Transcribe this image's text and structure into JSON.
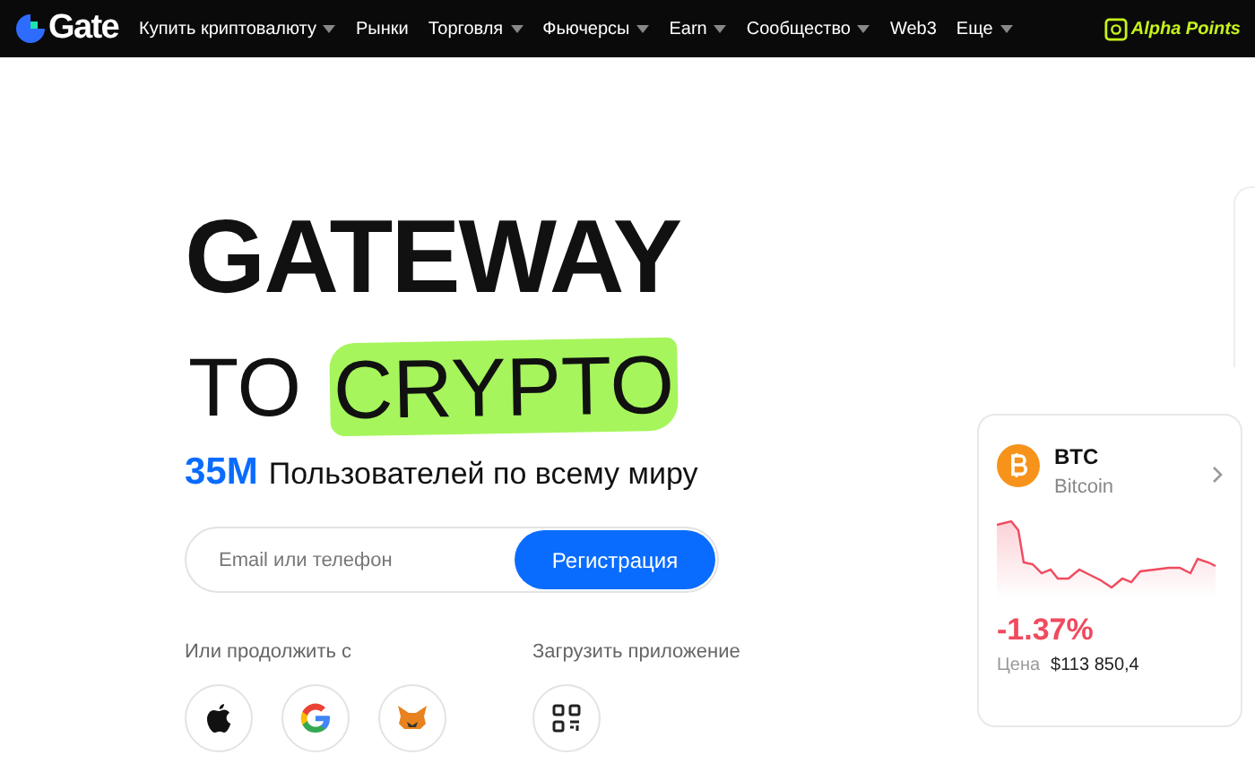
{
  "nav": {
    "logo": "Gate",
    "items": [
      {
        "label": "Купить криптовалюту",
        "dropdown": true
      },
      {
        "label": "Рынки",
        "dropdown": false
      },
      {
        "label": "Торговля",
        "dropdown": true
      },
      {
        "label": "Фьючерсы",
        "dropdown": true
      },
      {
        "label": "Earn",
        "dropdown": true
      },
      {
        "label": "Сообщество",
        "dropdown": true
      },
      {
        "label": "Web3",
        "dropdown": false
      },
      {
        "label": "Еще",
        "dropdown": true
      }
    ],
    "promo": "Alpha Points"
  },
  "hero": {
    "headline_1": "GATEWAY",
    "headline_2": [
      {
        "text": "TO",
        "highlighted": false
      },
      {
        "text": "CRYPTO",
        "highlighted": true
      }
    ],
    "stat_value": "35M",
    "stat_text": "Пользователей по всему миру",
    "signup": {
      "placeholder": "Email или телефон",
      "button": "Регистрация"
    },
    "continue_label": "Или продолжить с",
    "download_label": "Загрузить приложение",
    "socials": [
      {
        "kind": "apple"
      },
      {
        "kind": "google"
      },
      {
        "kind": "fox"
      }
    ]
  },
  "ticker": {
    "symbol": "BTC",
    "name": "Bitcoin",
    "change": "-1.37%",
    "price_label": "Цена",
    "price": "$113 850,4"
  }
}
